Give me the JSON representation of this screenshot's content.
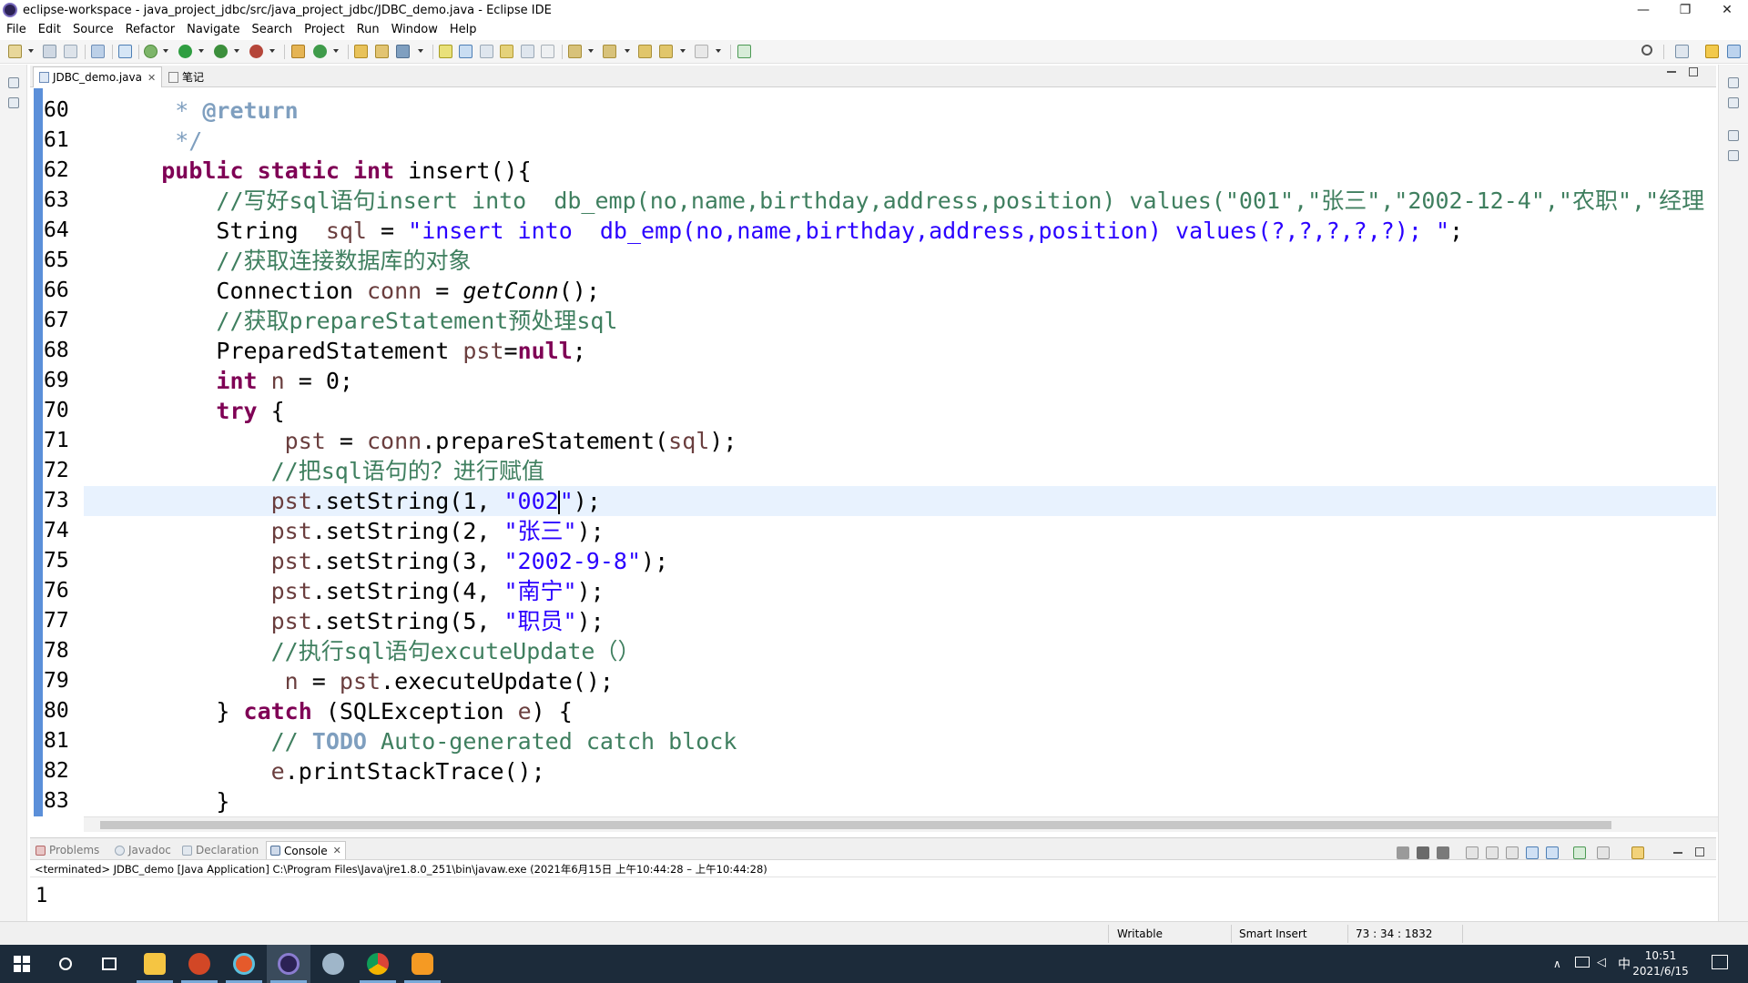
{
  "window": {
    "title": "eclipse-workspace - java_project_jdbc/src/java_project_jdbc/JDBC_demo.java - Eclipse IDE",
    "minimize": "—",
    "maximize": "❐",
    "close": "✕"
  },
  "menu": [
    "File",
    "Edit",
    "Source",
    "Refactor",
    "Navigate",
    "Search",
    "Project",
    "Run",
    "Window",
    "Help"
  ],
  "editor_tabs": [
    {
      "label": "JDBC_demo.java",
      "close": "✕"
    },
    {
      "label": "笔记"
    }
  ],
  "line_numbers": [
    "60",
    "61",
    "62",
    "63",
    "64",
    "65",
    "66",
    "67",
    "68",
    "69",
    "70",
    "71",
    "72",
    "73",
    "74",
    "75",
    "76",
    "77",
    "78",
    "79",
    "80",
    "81",
    "82",
    "83"
  ],
  "code_lines": [
    [
      {
        "t": "     ",
        "c": ""
      },
      {
        "t": "* ",
        "c": "jdoc-plain"
      },
      {
        "t": "@return",
        "c": "jdoc"
      }
    ],
    [
      {
        "t": "     */",
        "c": "jdoc-plain"
      }
    ],
    [
      {
        "t": "    ",
        "c": ""
      },
      {
        "t": "public",
        "c": "kw"
      },
      {
        "t": " ",
        "c": ""
      },
      {
        "t": "static",
        "c": "kw"
      },
      {
        "t": " ",
        "c": ""
      },
      {
        "t": "int",
        "c": "kw"
      },
      {
        "t": " insert(){",
        "c": ""
      }
    ],
    [
      {
        "t": "        //写好sql语句insert into  db_emp(no,name,birthday,address,position) values(\"001\",\"张三\",\"2002-12-4\",\"农职\",\"经理",
        "c": "cmt"
      }
    ],
    [
      {
        "t": "        String  ",
        "c": ""
      },
      {
        "t": "sql",
        "c": "var"
      },
      {
        "t": " = ",
        "c": ""
      },
      {
        "t": "\"insert into  db_emp(no,name,birthday,address,position) values(?,?,?,?,?); \"",
        "c": "str"
      },
      {
        "t": ";",
        "c": ""
      }
    ],
    [
      {
        "t": "        //获取连接数据库的对象",
        "c": "cmt"
      }
    ],
    [
      {
        "t": "        Connection ",
        "c": ""
      },
      {
        "t": "conn",
        "c": "var"
      },
      {
        "t": " = ",
        "c": ""
      },
      {
        "t": "getConn",
        "c": "it"
      },
      {
        "t": "();",
        "c": ""
      }
    ],
    [
      {
        "t": "        //获取prepareStatement预处理sql",
        "c": "cmt"
      }
    ],
    [
      {
        "t": "        PreparedStatement ",
        "c": ""
      },
      {
        "t": "pst",
        "c": "var"
      },
      {
        "t": "=",
        "c": ""
      },
      {
        "t": "null",
        "c": "kw"
      },
      {
        "t": ";",
        "c": ""
      }
    ],
    [
      {
        "t": "        ",
        "c": ""
      },
      {
        "t": "int",
        "c": "kw"
      },
      {
        "t": " ",
        "c": ""
      },
      {
        "t": "n",
        "c": "var"
      },
      {
        "t": " = 0;",
        "c": ""
      }
    ],
    [
      {
        "t": "        ",
        "c": ""
      },
      {
        "t": "try",
        "c": "kw"
      },
      {
        "t": " {",
        "c": ""
      }
    ],
    [
      {
        "t": "             ",
        "c": ""
      },
      {
        "t": "pst",
        "c": "var"
      },
      {
        "t": " = ",
        "c": ""
      },
      {
        "t": "conn",
        "c": "var"
      },
      {
        "t": ".prepareStatement(",
        "c": ""
      },
      {
        "t": "sql",
        "c": "var"
      },
      {
        "t": ");",
        "c": ""
      }
    ],
    [
      {
        "t": "            //把sql语句的？进行赋值",
        "c": "cmt"
      }
    ],
    [
      {
        "t": "            ",
        "c": ""
      },
      {
        "t": "pst",
        "c": "var"
      },
      {
        "t": ".setString(1, ",
        "c": ""
      },
      {
        "t": "\"002",
        "c": "str"
      },
      {
        "t": "",
        "c": "caret"
      },
      {
        "t": "\"",
        "c": "str"
      },
      {
        "t": ");",
        "c": ""
      }
    ],
    [
      {
        "t": "            ",
        "c": ""
      },
      {
        "t": "pst",
        "c": "var"
      },
      {
        "t": ".setString(2, ",
        "c": ""
      },
      {
        "t": "\"张三\"",
        "c": "str"
      },
      {
        "t": ");",
        "c": ""
      }
    ],
    [
      {
        "t": "            ",
        "c": ""
      },
      {
        "t": "pst",
        "c": "var"
      },
      {
        "t": ".setString(3, ",
        "c": ""
      },
      {
        "t": "\"2002-9-8\"",
        "c": "str"
      },
      {
        "t": ");",
        "c": ""
      }
    ],
    [
      {
        "t": "            ",
        "c": ""
      },
      {
        "t": "pst",
        "c": "var"
      },
      {
        "t": ".setString(4, ",
        "c": ""
      },
      {
        "t": "\"南宁\"",
        "c": "str"
      },
      {
        "t": ");",
        "c": ""
      }
    ],
    [
      {
        "t": "            ",
        "c": ""
      },
      {
        "t": "pst",
        "c": "var"
      },
      {
        "t": ".setString(5, ",
        "c": ""
      },
      {
        "t": "\"职员\"",
        "c": "str"
      },
      {
        "t": ");",
        "c": ""
      }
    ],
    [
      {
        "t": "            //执行sql语句excuteUpdate（）",
        "c": "cmt"
      }
    ],
    [
      {
        "t": "             ",
        "c": ""
      },
      {
        "t": "n",
        "c": "var"
      },
      {
        "t": " = ",
        "c": ""
      },
      {
        "t": "pst",
        "c": "var"
      },
      {
        "t": ".executeUpdate();",
        "c": ""
      }
    ],
    [
      {
        "t": "        } ",
        "c": ""
      },
      {
        "t": "catch",
        "c": "kw"
      },
      {
        "t": " (SQLException ",
        "c": ""
      },
      {
        "t": "e",
        "c": "var"
      },
      {
        "t": ") {",
        "c": ""
      }
    ],
    [
      {
        "t": "            // ",
        "c": "cmt"
      },
      {
        "t": "TODO",
        "c": "todo"
      },
      {
        "t": " Auto-generated catch block",
        "c": "cmt"
      }
    ],
    [
      {
        "t": "            ",
        "c": ""
      },
      {
        "t": "e",
        "c": "var"
      },
      {
        "t": ".printStackTrace();",
        "c": ""
      }
    ],
    [
      {
        "t": "        }",
        "c": ""
      }
    ]
  ],
  "console_tabs": [
    {
      "label": "Problems"
    },
    {
      "label": "Javadoc"
    },
    {
      "label": "Declaration"
    },
    {
      "label": "Console",
      "close": "✕"
    }
  ],
  "console": {
    "description": "<terminated> JDBC_demo [Java Application] C:\\Program Files\\Java\\jre1.8.0_251\\bin\\javaw.exe  (2021年6月15日 上午10:44:28 – 上午10:44:28)",
    "output": "1"
  },
  "status": {
    "writable": "Writable",
    "insert_mode": "Smart Insert",
    "position": "73 : 34 : 1832"
  },
  "taskbar": {
    "time": "10:51",
    "date": "2021/6/15",
    "ime": "中"
  },
  "colors": {
    "keyword": "#7f0055",
    "string": "#2a00ff",
    "comment": "#3f7f5f",
    "javadoc": "#7f9fbf",
    "current_line": "#e8f2fe",
    "ruler": "#5b8fd9"
  }
}
